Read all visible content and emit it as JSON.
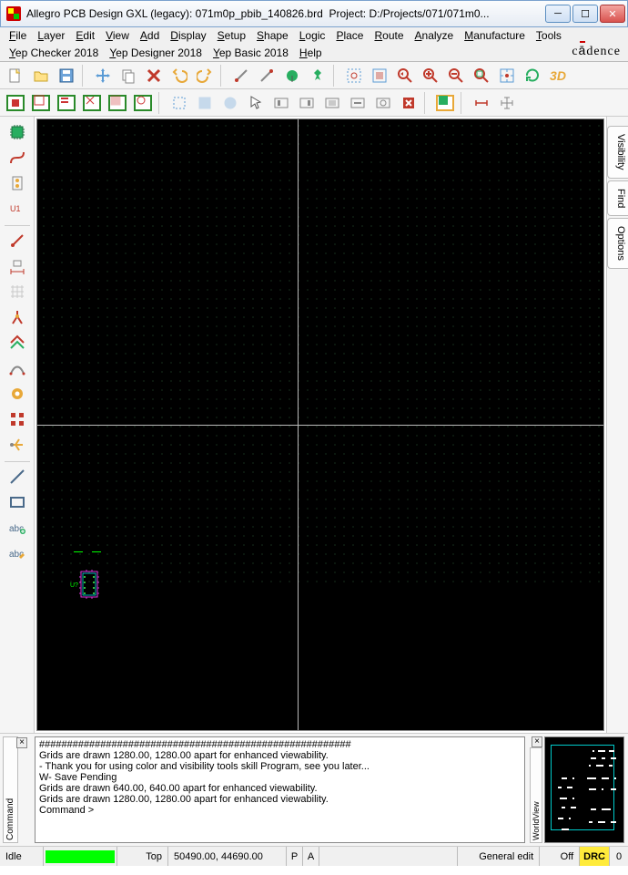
{
  "title": {
    "app": "Allegro PCB Design GXL (legacy):",
    "file": "071m0p_pbib_140826.brd",
    "project_label": "Project:",
    "project_path": "D:/Projects/071/071m0..."
  },
  "brand": "cādence",
  "menus": {
    "file": "File",
    "layer": "Layer",
    "edit": "Edit",
    "view": "View",
    "add": "Add",
    "display": "Display",
    "setup": "Setup",
    "shape": "Shape",
    "logic": "Logic",
    "place": "Place",
    "route": "Route",
    "analyze": "Analyze",
    "manufacture": "Manufacture",
    "tools": "Tools",
    "yep_checker": "Yep Checker 2018",
    "yep_designer": "Yep Designer 2018",
    "yep_basic": "Yep Basic 2018",
    "help": "Help"
  },
  "toolbar1_icons": [
    "new-file-icon",
    "open-icon",
    "save-icon",
    "sep",
    "move-icon",
    "copy-icon",
    "delete-icon",
    "undo-icon",
    "redo-icon",
    "sep",
    "flag-a-icon",
    "flag-b-icon",
    "marker-icon",
    "pin-icon",
    "sep",
    "zoom-window-icon",
    "zoom-fit-icon",
    "zoom-prev-icon",
    "zoom-in-icon",
    "zoom-out-icon",
    "zoom-sel-icon",
    "zoom-extents-icon",
    "refresh-icon",
    "3d-icon"
  ],
  "toolbar2_icons": [
    "disp-full-icon",
    "disp-a-icon",
    "disp-b-icon",
    "disp-c-icon",
    "disp-d-icon",
    "disp-e-icon",
    "sep",
    "select-rect-icon",
    "select-all-icon",
    "select-circle-icon",
    "pointer-icon",
    "group-a-icon",
    "group-b-icon",
    "group-c-icon",
    "group-d-icon",
    "group-e-icon",
    "warn-icon",
    "sep",
    "layer-icon",
    "sep",
    "dim-a-icon",
    "dim-b-icon"
  ],
  "left_tools": [
    "chip-green-icon",
    "trace-icon",
    "solder-icon",
    "text-label-icon",
    "sep",
    "probe-icon",
    "dimension-icon",
    "grid-ref-icon",
    "branch-icon",
    "route-net-icon",
    "stitch-icon",
    "via-icon",
    "array-icon",
    "clock-icon",
    "sep",
    "line-icon",
    "rect-outline-icon",
    "text-add-icon",
    "text-edit-icon"
  ],
  "right_tabs": {
    "visibility": "Visibility",
    "find": "Find",
    "options": "Options"
  },
  "command_log": {
    "label": "Command",
    "lines": [
      "########################################################",
      "Grids are drawn 1280.00, 1280.00 apart for enhanced viewability.",
      " - Thank you for using color and visibility tools skill Program, see you later...",
      "W- Save Pending",
      "Grids are drawn 640.00, 640.00 apart for enhanced viewability.",
      "Grids are drawn 1280.00, 1280.00 apart for enhanced viewability.",
      "Command >"
    ]
  },
  "worldview": {
    "label": "WorldView"
  },
  "status": {
    "idle": "Idle",
    "layer": "Top",
    "coords": "50490.00, 44690.00",
    "pa": "P",
    "pa2": "A",
    "mode": "General edit",
    "snap": "Off",
    "drc": "DRC",
    "drc_count": "0"
  },
  "canvas": {
    "component_ref": "U?"
  }
}
